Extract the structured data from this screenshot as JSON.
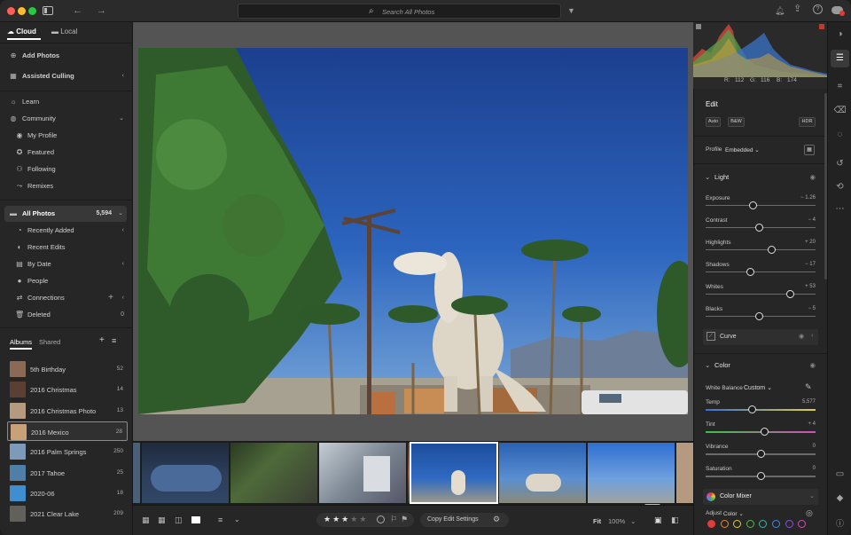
{
  "search": {
    "placeholder": "Search All Photos"
  },
  "tabs": [
    {
      "label": "Cloud"
    },
    {
      "label": "Local"
    }
  ],
  "nav": {
    "add_photos": "Add Photos",
    "assisted_culling": "Assisted Culling",
    "learn": "Learn",
    "community": "Community",
    "my_profile": "My Profile",
    "featured": "Featured",
    "following": "Following",
    "remixes": "Remixes",
    "all_photos": "All Photos",
    "all_photos_count": "5,594",
    "recently_added": "Recently Added",
    "recent_edits": "Recent Edits",
    "by_date": "By Date",
    "people": "People",
    "connections": "Connections",
    "deleted": "Deleted",
    "deleted_count": "0"
  },
  "album_tabs": [
    {
      "label": "Albums"
    },
    {
      "label": "Shared"
    }
  ],
  "albums": [
    {
      "name": "5th Birthday",
      "count": "52",
      "color": "#8a6a55"
    },
    {
      "name": "2016 Christmas",
      "count": "14",
      "color": "#5a3f33"
    },
    {
      "name": "2016 Christmas Photo",
      "count": "13",
      "color": "#b49a7e"
    },
    {
      "name": "2016 Mexico",
      "count": "28",
      "color": "#c8a178"
    },
    {
      "name": "2016 Palm Springs",
      "count": "250",
      "color": "#7d9bb8"
    },
    {
      "name": "2017 Tahoe",
      "count": "25",
      "color": "#4f7ea6"
    },
    {
      "name": "2020-06",
      "count": "18",
      "color": "#3f8fd0"
    },
    {
      "name": "2021 Clear Lake",
      "count": "209",
      "color": "#61605b"
    }
  ],
  "histogram": {
    "r": "112",
    "g": "116",
    "b": "174",
    "r_label": "R:",
    "g_label": "G:",
    "b_label": "B:"
  },
  "edit": {
    "title": "Edit",
    "auto": "Auto",
    "bw": "B&W",
    "hdr": "HDR",
    "profile_label": "Profile",
    "profile_value": "Embedded",
    "light": "Light",
    "sliders": [
      {
        "name": "Exposure",
        "value": "− 1.26",
        "pos": 0.43
      },
      {
        "name": "Contrast",
        "value": "− 4",
        "pos": 0.49
      },
      {
        "name": "Highlights",
        "value": "+ 20",
        "pos": 0.6
      },
      {
        "name": "Shadows",
        "value": "− 17",
        "pos": 0.41
      },
      {
        "name": "Whites",
        "value": "+ 53",
        "pos": 0.77
      },
      {
        "name": "Blacks",
        "value": "− 5",
        "pos": 0.49
      }
    ],
    "curve": "Curve",
    "color": "Color",
    "white_balance_label": "White Balance",
    "white_balance_value": "Custom",
    "color_sliders": [
      {
        "name": "Temp",
        "value": "5,577",
        "pos": 0.42
      },
      {
        "name": "Tint",
        "value": "+ 4",
        "pos": 0.54
      },
      {
        "name": "Vibrance",
        "value": "0",
        "pos": 0.5
      },
      {
        "name": "Saturation",
        "value": "0",
        "pos": 0.5
      }
    ],
    "color_mixer": "Color Mixer",
    "adjust_label": "Adjust",
    "adjust_value": "Color",
    "mixer_colors": [
      "#e23b3b",
      "#e98a2b",
      "#e1cf35",
      "#53b94b",
      "#3bb8a4",
      "#3b8fe2",
      "#8b4fe0",
      "#d04fb8"
    ]
  },
  "toolbar": {
    "copy_edit": "Copy Edit Settings",
    "fit": "Fit",
    "zoom": "100%",
    "rating": 3
  },
  "colors": {
    "accent": "#3a8fd8",
    "panel": "#262626"
  }
}
